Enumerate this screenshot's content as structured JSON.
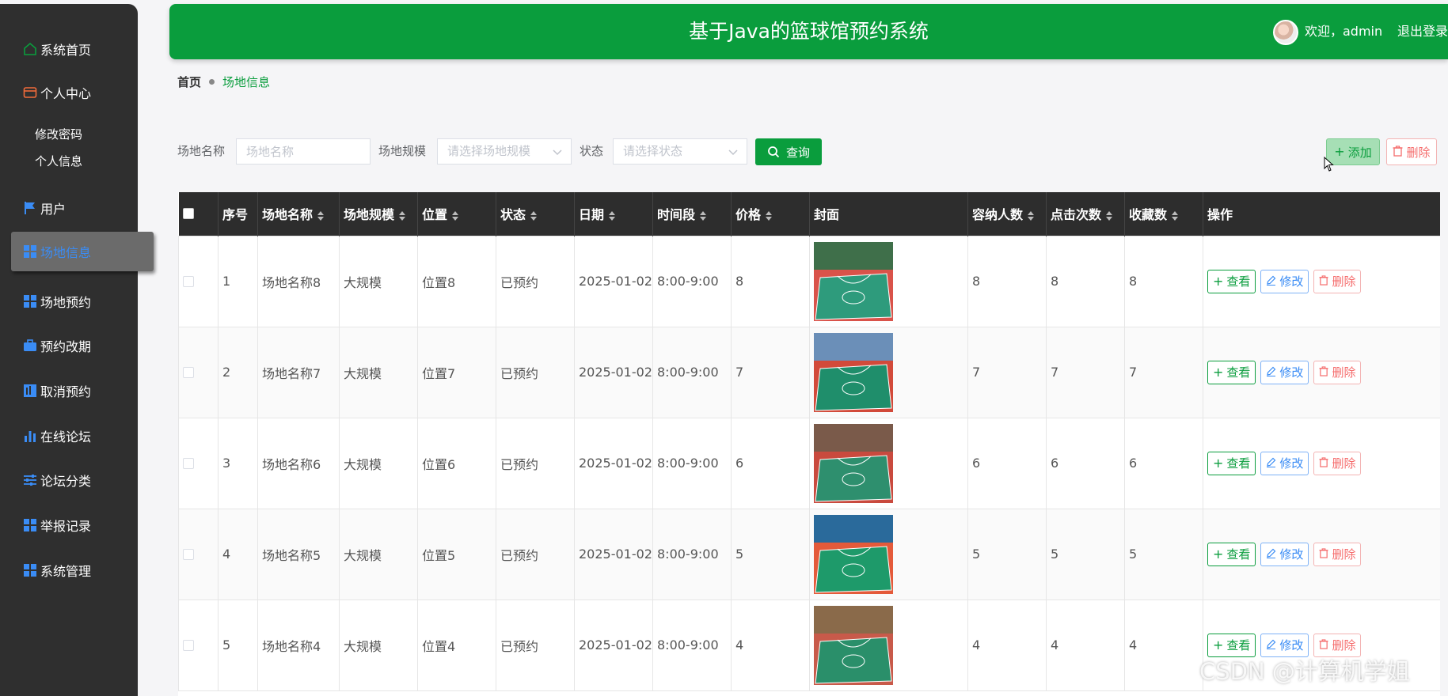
{
  "header": {
    "title": "基于Java的篮球馆预约系统",
    "welcome": "欢迎，admin",
    "logout": "退出登录"
  },
  "sidebar": {
    "items": [
      {
        "label": "系统首页",
        "icon": "home-icon"
      },
      {
        "label": "个人中心",
        "icon": "wallet-icon"
      },
      {
        "label": "用户",
        "icon": "flag-icon"
      },
      {
        "label": "场地信息",
        "icon": "grid-icon"
      },
      {
        "label": "场地预约",
        "icon": "grid-icon"
      },
      {
        "label": "预约改期",
        "icon": "briefcase-icon"
      },
      {
        "label": "取消预约",
        "icon": "chart-icon"
      },
      {
        "label": "在线论坛",
        "icon": "bar-chart-icon"
      },
      {
        "label": "论坛分类",
        "icon": "sliders-icon"
      },
      {
        "label": "举报记录",
        "icon": "grid-icon"
      },
      {
        "label": "系统管理",
        "icon": "grid-icon"
      }
    ],
    "sub_items": [
      "修改密码",
      "个人信息"
    ],
    "active": "场地信息"
  },
  "breadcrumb": {
    "home": "首页",
    "current": "场地信息"
  },
  "search": {
    "name_label": "场地名称",
    "name_placeholder": "场地名称",
    "scale_label": "场地规模",
    "scale_placeholder": "请选择场地规模",
    "status_label": "状态",
    "status_placeholder": "请选择状态",
    "query_label": "查询"
  },
  "actions": {
    "add_label": "添加",
    "delete_label": "删除"
  },
  "table": {
    "columns": [
      "序号",
      "场地名称",
      "场地规模",
      "位置",
      "状态",
      "日期",
      "时间段",
      "价格",
      "封面",
      "容纳人数",
      "点击次数",
      "收藏数",
      "操作"
    ],
    "rows": [
      {
        "idx": "1",
        "name": "场地名称8",
        "scale": "大规模",
        "location": "位置8",
        "status": "已预约",
        "date": "2025-01-02",
        "time": "8:00-9:00",
        "price": "8",
        "capacity": "8",
        "clicks": "8",
        "favorites": "8"
      },
      {
        "idx": "2",
        "name": "场地名称7",
        "scale": "大规模",
        "location": "位置7",
        "status": "已预约",
        "date": "2025-01-02",
        "time": "8:00-9:00",
        "price": "7",
        "capacity": "7",
        "clicks": "7",
        "favorites": "7"
      },
      {
        "idx": "3",
        "name": "场地名称6",
        "scale": "大规模",
        "location": "位置6",
        "status": "已预约",
        "date": "2025-01-02",
        "time": "8:00-9:00",
        "price": "6",
        "capacity": "6",
        "clicks": "6",
        "favorites": "6"
      },
      {
        "idx": "4",
        "name": "场地名称5",
        "scale": "大规模",
        "location": "位置5",
        "status": "已预约",
        "date": "2025-01-02",
        "time": "8:00-9:00",
        "price": "5",
        "capacity": "5",
        "clicks": "5",
        "favorites": "5"
      },
      {
        "idx": "5",
        "name": "场地名称4",
        "scale": "大规模",
        "location": "位置4",
        "status": "已预约",
        "date": "2025-01-02",
        "time": "8:00-9:00",
        "price": "4",
        "capacity": "4",
        "clicks": "4",
        "favorites": "4"
      }
    ],
    "row_actions": {
      "view": "查看",
      "edit": "修改",
      "delete": "删除"
    }
  },
  "watermark": "CSDN @计算机学姐",
  "colors": {
    "primary": "#0a9d3d",
    "sidebar": "#2f2f2f",
    "active_text": "#3a8cf5",
    "danger": "#f56c6c"
  }
}
